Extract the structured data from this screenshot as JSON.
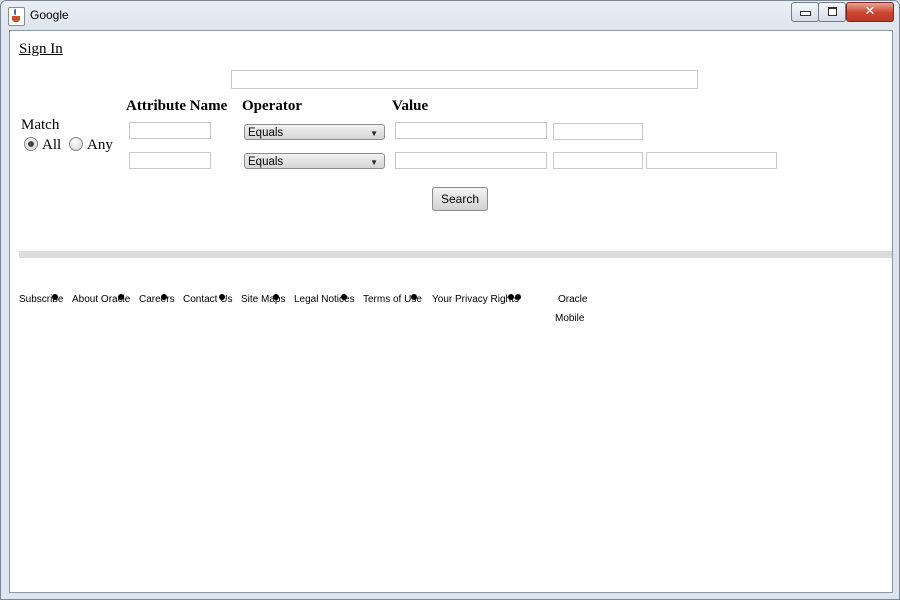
{
  "window": {
    "title": "Google",
    "controls": {
      "close": "✕"
    }
  },
  "page": {
    "sign_in": "Sign In",
    "search_field": {
      "value": "",
      "placeholder": ""
    },
    "headers": {
      "attribute_name": "Attribute Name",
      "operator": "Operator",
      "value": "Value"
    },
    "match": {
      "label": "Match",
      "options": [
        "All",
        "Any"
      ],
      "selected": "All"
    },
    "rows": [
      {
        "attribute": "",
        "operator": "Equals",
        "values": [
          "",
          ""
        ]
      },
      {
        "attribute": "",
        "operator": "Equals",
        "values": [
          "",
          "",
          ""
        ]
      }
    ],
    "search_button": "Search",
    "footer_links": [
      "Subscribe",
      "About Oracle",
      "Careers",
      "Contact Us",
      "Site Maps",
      "Legal Notices",
      "Terms of Use",
      "Your Privacy Rights",
      "Oracle",
      "Mobile"
    ]
  }
}
